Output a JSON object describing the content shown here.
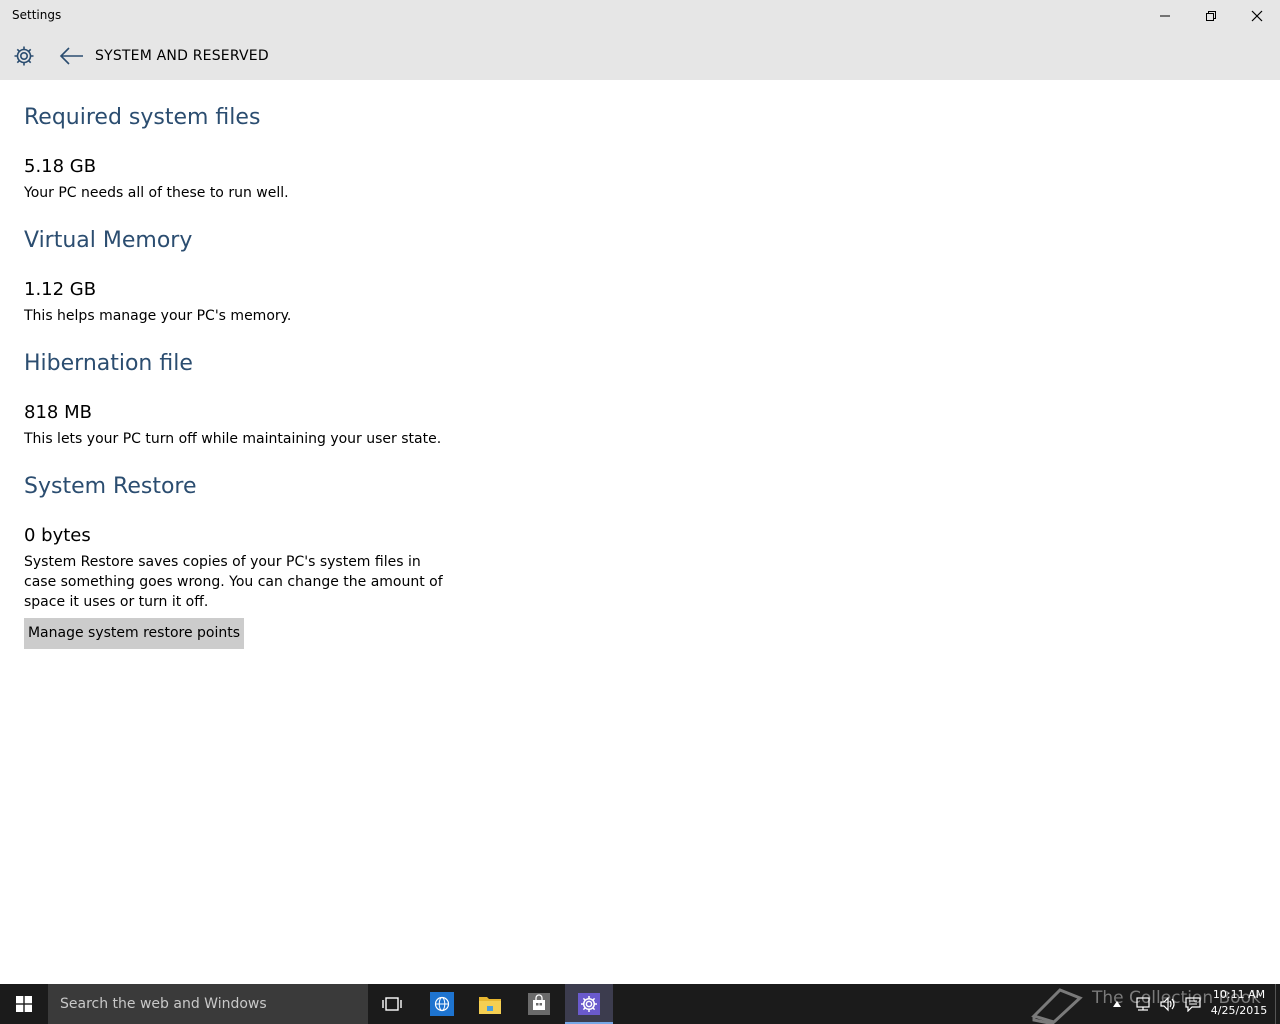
{
  "window": {
    "title": "Settings"
  },
  "header": {
    "page_title": "SYSTEM AND RESERVED"
  },
  "sections": [
    {
      "title": "Required system files",
      "size": "5.18 GB",
      "description": "Your PC needs all of these to run well."
    },
    {
      "title": "Virtual Memory",
      "size": "1.12 GB",
      "description": "This helps manage your PC's memory."
    },
    {
      "title": "Hibernation file",
      "size": "818 MB",
      "description": "This lets your PC turn off while maintaining your user state."
    },
    {
      "title": "System Restore",
      "size": "0 bytes",
      "description": "System Restore saves copies of your PC's system files in case something goes wrong. You can change the amount of space it uses or turn it off."
    }
  ],
  "restore_button_label": "Manage system restore points",
  "taskbar": {
    "search_placeholder": "Search the web and Windows",
    "watermark": "The Collection Book",
    "clock_time": "10:11 AM",
    "clock_date": "4/25/2015"
  },
  "colors": {
    "section_title": "#2b4d70",
    "header_background": "#e6e6e6",
    "taskbar_background": "#1b1b1b",
    "settings_icon_accent": "#6a5acd"
  },
  "icons": {
    "app": "gear-icon",
    "back": "arrow-left-icon",
    "minimize": "minimize-icon",
    "maximize": "restore-icon",
    "close": "close-icon",
    "start": "windows-logo-icon",
    "task_view": "task-view-icon",
    "browser": "globe-icon",
    "explorer": "folder-icon",
    "store": "store-icon",
    "settings": "gear-icon",
    "tray_up": "chevron-up-icon",
    "network": "network-icon",
    "volume": "speaker-icon",
    "notifications": "message-icon"
  }
}
